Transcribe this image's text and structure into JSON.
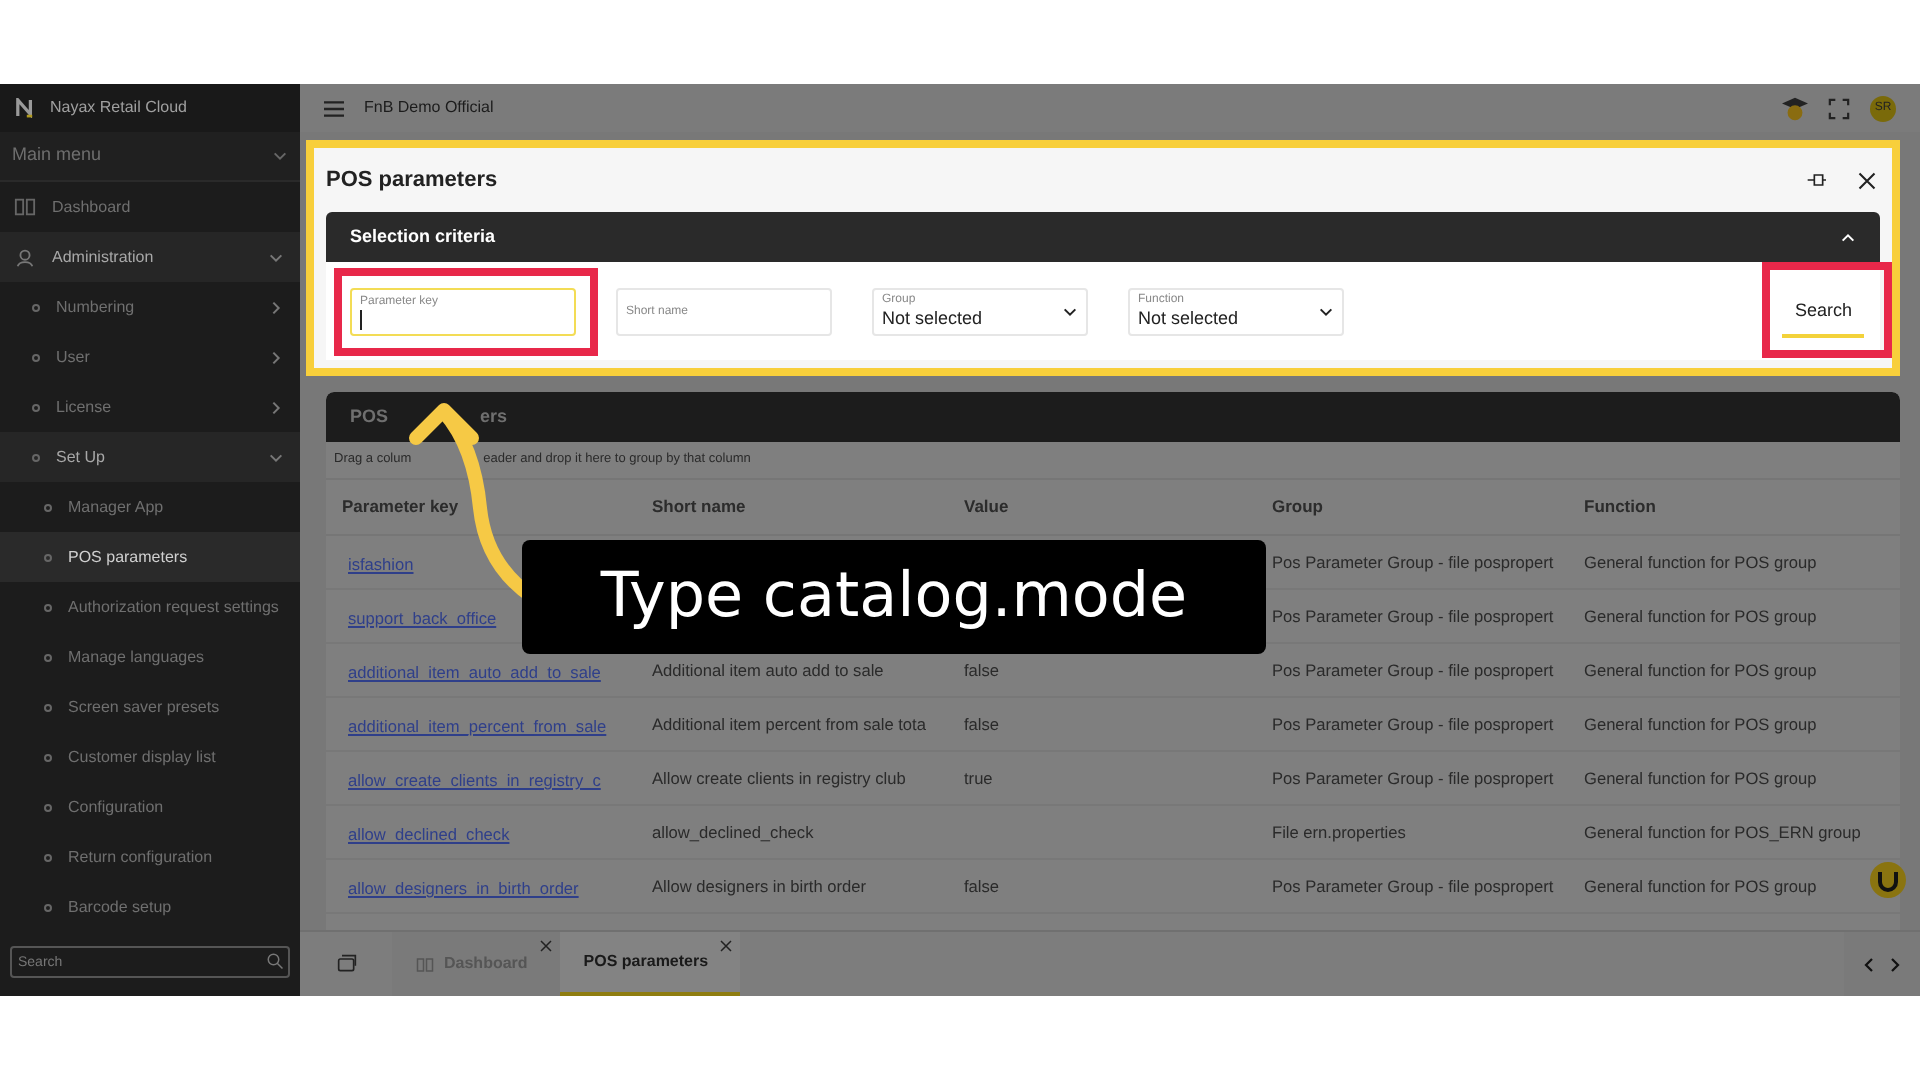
{
  "sidebar": {
    "brand": "Nayax Retail Cloud",
    "main_menu": "Main menu",
    "items": [
      {
        "label": "Dashboard",
        "kind": "page",
        "selected": false
      },
      {
        "label": "Administration",
        "kind": "group",
        "selected": false,
        "expanded": true,
        "children": [
          {
            "label": "Numbering",
            "kind": "group",
            "selected": false,
            "expanded": false
          },
          {
            "label": "User",
            "kind": "group",
            "selected": false,
            "expanded": false
          },
          {
            "label": "License",
            "kind": "group",
            "selected": false,
            "expanded": false
          },
          {
            "label": "Set Up",
            "kind": "group",
            "selected": false,
            "expanded": true,
            "children": [
              {
                "label": "Manager App",
                "kind": "page",
                "selected": false
              },
              {
                "label": "POS parameters",
                "kind": "page",
                "selected": true
              },
              {
                "label": "Authorization request settings",
                "kind": "page",
                "selected": false
              },
              {
                "label": "Manage languages",
                "kind": "page",
                "selected": false
              },
              {
                "label": "Screen saver presets",
                "kind": "page",
                "selected": false
              },
              {
                "label": "Customer display list",
                "kind": "page",
                "selected": false
              },
              {
                "label": "Configuration",
                "kind": "page",
                "selected": false
              },
              {
                "label": "Return configuration",
                "kind": "page",
                "selected": false
              },
              {
                "label": "Barcode setup",
                "kind": "page",
                "selected": false
              }
            ]
          }
        ]
      }
    ],
    "search": {
      "placeholder": "Search"
    }
  },
  "top_bar": {
    "company": "FnB Demo Official",
    "avatar": "SR"
  },
  "panel": {
    "title": "POS parameters",
    "criteria_title": "Selection criteria",
    "fields": [
      {
        "kind": "text",
        "label": "Parameter key",
        "focused": true
      },
      {
        "kind": "text",
        "label": "Short name",
        "focused": false
      },
      {
        "kind": "select",
        "label": "Group",
        "value": "Not selected",
        "focused": false
      },
      {
        "kind": "select",
        "label": "Function",
        "value": "Not selected",
        "focused": false
      }
    ],
    "search_button": "Search"
  },
  "table": {
    "title": [
      "POS",
      "ers"
    ],
    "group_hint": [
      "Drag a colum",
      "eader and drop it here to group by that column"
    ],
    "columns": [
      "Parameter key",
      "Short name",
      "Value",
      "Group",
      "Function"
    ],
    "rows": [
      [
        "isfashion",
        "",
        "",
        "Pos Parameter Group - file pospropert",
        "General function for POS group"
      ],
      [
        "support_back_office",
        "",
        "",
        "Pos Parameter Group - file pospropert",
        "General function for POS group"
      ],
      [
        "additional_item_auto_add_to_sale",
        "Additional item auto add to sale",
        "false",
        "Pos Parameter Group - file pospropert",
        "General function for POS group"
      ],
      [
        "additional_item_percent_from_sale",
        "Additional item percent from sale tota",
        "false",
        "Pos Parameter Group - file pospropert",
        "General function for POS group"
      ],
      [
        "allow_create_clients_in_registry_c",
        "Allow create clients in registry club",
        "true",
        "Pos Parameter Group - file pospropert",
        "General function for POS group"
      ],
      [
        "allow_declined_check",
        "allow_declined_check",
        "",
        "File ern.properties",
        "General function for POS_ERN group"
      ],
      [
        "allow_designers_in_birth_order",
        "Allow designers in birth order",
        "false",
        "Pos Parameter Group - file pospropert",
        "General function for POS group"
      ]
    ]
  },
  "bottom_tabs": [
    {
      "label": "Dashboard",
      "selected": false
    },
    {
      "label": "POS parameters",
      "selected": true
    }
  ],
  "callout": "Type catalog.mode"
}
